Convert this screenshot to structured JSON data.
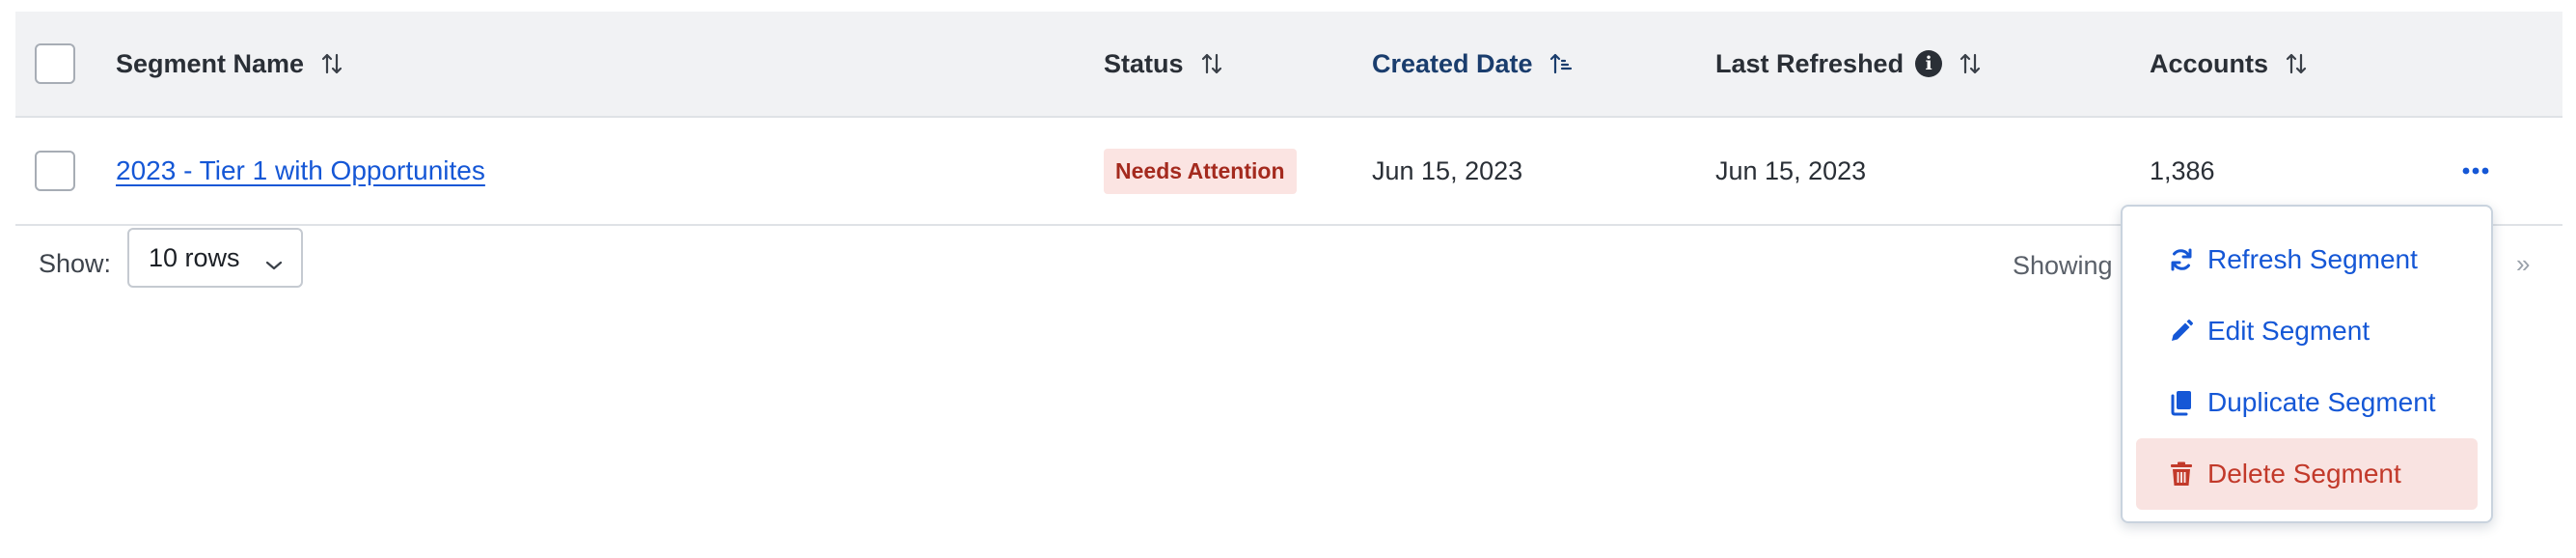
{
  "table": {
    "headers": {
      "segment_name": "Segment Name",
      "status": "Status",
      "created_date": "Created Date",
      "last_refreshed": "Last Refreshed",
      "accounts": "Accounts"
    },
    "rows": [
      {
        "segment_name": "2023 - Tier 1 with Opportunites",
        "status": "Needs Attention",
        "created_date": "Jun 15, 2023",
        "last_refreshed": "Jun 15, 2023",
        "accounts": "1,386"
      }
    ]
  },
  "footer": {
    "show_label": "Show:",
    "rows_selected": "10 rows",
    "showing_text": "Showing",
    "last_page_glyph": "»"
  },
  "row_menu": {
    "items": [
      {
        "label": "Refresh Segment",
        "icon": "refresh-icon"
      },
      {
        "label": "Edit Segment",
        "icon": "pencil-icon"
      },
      {
        "label": "Duplicate Segment",
        "icon": "copy-icon"
      },
      {
        "label": "Delete Segment",
        "icon": "trash-icon"
      }
    ]
  },
  "colors": {
    "link": "#1557d6",
    "header_bg": "#f1f2f4",
    "active_sort": "#1a3d6d",
    "badge_bg": "#fbe4e2",
    "badge_text": "#a42a1e",
    "danger_bg": "#f9e3e1",
    "danger_text": "#c2392a"
  }
}
